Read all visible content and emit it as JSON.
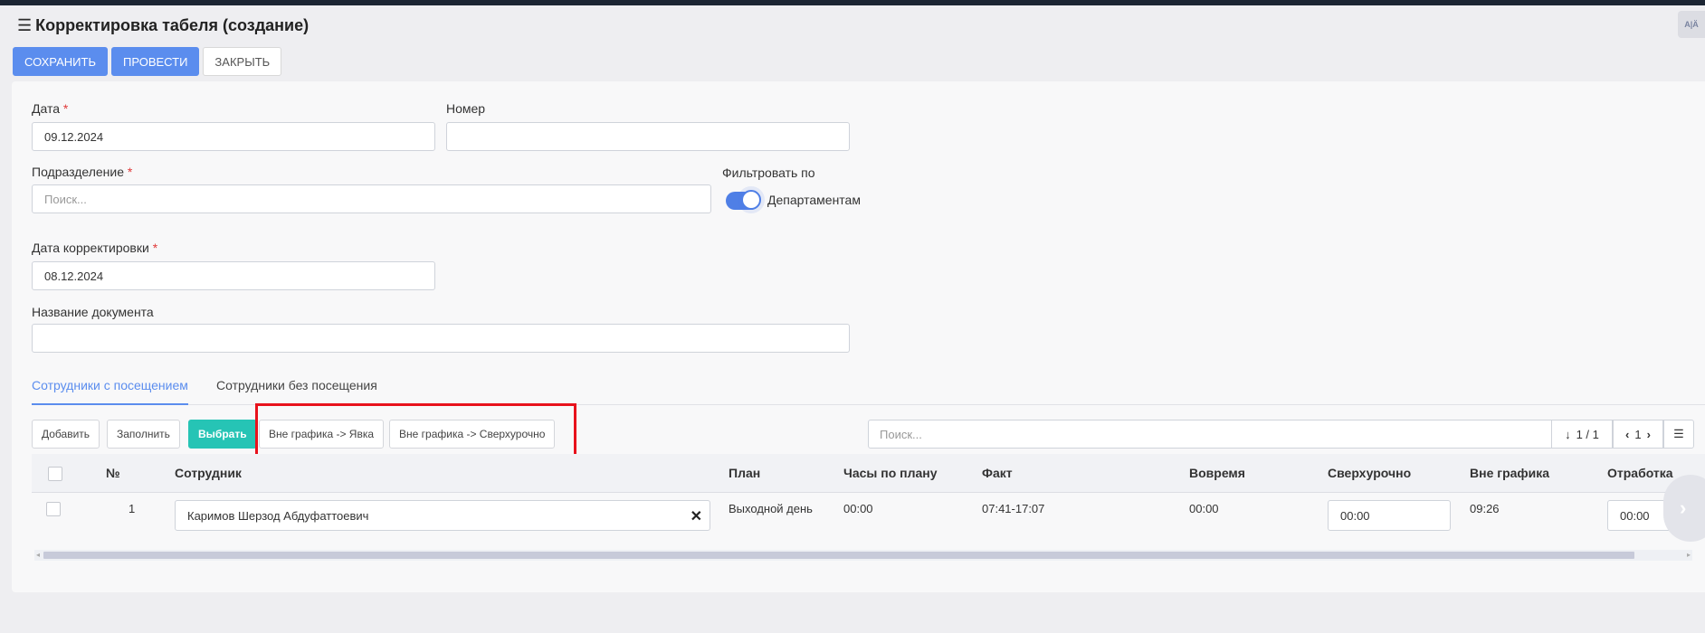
{
  "header": {
    "title": "Корректировка табеля (создание)",
    "menu_icon": "hamburger-icon",
    "lang_icon": "translate-icon"
  },
  "actions": {
    "save": "СОХРАНИТЬ",
    "post": "ПРОВЕСТИ",
    "close": "ЗАКРЫТЬ"
  },
  "form": {
    "date_label": "Дата",
    "date_value": "09.12.2024",
    "number_label": "Номер",
    "number_value": "",
    "division_label": "Подразделение",
    "division_placeholder": "Поиск...",
    "filter_label": "Фильтровать по",
    "filter_option": "Департаментам",
    "filter_on": true,
    "corr_date_label": "Дата корректировки",
    "corr_date_value": "08.12.2024",
    "doc_name_label": "Название документа",
    "doc_name_value": "",
    "required_mark": "*"
  },
  "tabs": [
    {
      "label": "Сотрудники с посещением",
      "active": true
    },
    {
      "label": "Сотрудники без посещения",
      "active": false
    }
  ],
  "table_toolbar": {
    "add": "Добавить",
    "fill": "Заполнить",
    "select": "Выбрать",
    "off_schedule_attendance": "Вне графика -> Явка",
    "off_schedule_overtime": "Вне графика -> Сверхурочно",
    "search_placeholder": "Поиск...",
    "sort_info": "1 / 1",
    "page": "1",
    "menu_icon": "list-menu-icon"
  },
  "table": {
    "columns": [
      "№",
      "Сотрудник",
      "План",
      "Часы по плану",
      "Факт",
      "Вовремя",
      "Сверхурочно",
      "Вне графика",
      "Отработка"
    ],
    "rows": [
      {
        "num": "1",
        "employee": "Каримов Шерзод Абдуфаттоевич",
        "plan": "Выходной день",
        "plan_hours": "00:00",
        "fact": "07:41-17:07",
        "on_time": "00:00",
        "overtime": "00:00",
        "off_schedule": "09:26",
        "worked": "00:00"
      }
    ]
  },
  "colors": {
    "primary": "#5b8dee",
    "teal": "#26c4b5",
    "highlight": "#e8121c"
  }
}
